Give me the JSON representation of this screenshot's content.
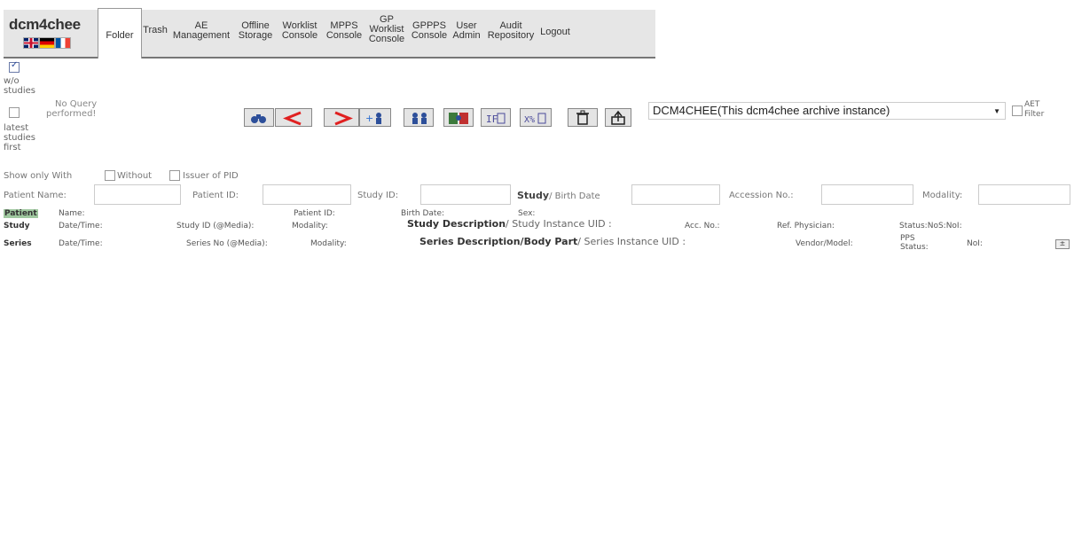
{
  "app": {
    "logo_text": "dcm4chee"
  },
  "nav": {
    "tabs": [
      {
        "lines": [
          "Folder"
        ]
      },
      {
        "lines": [
          "Trash"
        ]
      },
      {
        "lines": [
          "AE",
          "Management"
        ]
      },
      {
        "lines": [
          "Offline",
          "Storage"
        ]
      },
      {
        "lines": [
          "Worklist",
          "Console"
        ]
      },
      {
        "lines": [
          "MPPS",
          "Console"
        ]
      },
      {
        "lines": [
          "GP",
          "Worklist",
          "Console"
        ]
      },
      {
        "lines": [
          "GPPPS",
          "Console"
        ]
      },
      {
        "lines": [
          "User",
          "Admin"
        ]
      },
      {
        "lines": [
          "Audit",
          "Repository"
        ]
      },
      {
        "lines": [
          "Logout"
        ]
      }
    ]
  },
  "filters": {
    "wo_studies_checked": true,
    "wo_studies_label": [
      "w/o",
      "studies"
    ],
    "latest_first_label": [
      "latest",
      "studies",
      "first"
    ],
    "query_status": [
      "No Query",
      "performed!"
    ],
    "aet_selected": "DCM4CHEE(This dcm4chee archive instance)",
    "aet_filter_label": [
      "AET",
      "Filter"
    ],
    "show_only": "Show only",
    "with": "With",
    "without": "Without",
    "issuer_of_pid": "Issuer of PID"
  },
  "toolbar": {
    "buttons": [
      {
        "icon": "binoculars-search-icon"
      },
      {
        "icon": "previous-arrow-icon"
      },
      {
        "icon": "next-arrow-icon"
      },
      {
        "icon": "add-patient-icon"
      },
      {
        "icon": "merge-patients-icon"
      },
      {
        "icon": "move-patients-icon"
      },
      {
        "icon": "export-study-icon"
      },
      {
        "icon": "compare-studies-icon"
      },
      {
        "icon": "delete-trash-icon"
      },
      {
        "icon": "send-upload-icon"
      }
    ]
  },
  "search": {
    "patient_name": "Patient Name:",
    "patient_id": "Patient ID:",
    "study_id": "Study ID:",
    "study": "Study",
    "birth_date": "/ Birth Date",
    "accession_no": "Accession No.:",
    "modality": "Modality:"
  },
  "headers": {
    "patient": {
      "tag": "Patient",
      "name": "Name:",
      "patient_id": "Patient ID:",
      "birth_date": "Birth Date:",
      "sex": "Sex:"
    },
    "study": {
      "tag": "Study",
      "datetime": "Date/Time:",
      "study_id": "Study ID (@Media):",
      "modality": "Modality:",
      "description_bold": "Study Description",
      "description_rest": "/ Study Instance UID :",
      "acc_no": "Acc. No.:",
      "ref_physician": "Ref. Physician:",
      "status": "Status:NoS:NoI:"
    },
    "series": {
      "tag": "Series",
      "datetime": "Date/Time:",
      "series_no": "Series No (@Media):",
      "modality": "Modality:",
      "description_bold": "Series Description/Body Part",
      "description_rest": "/ Series Instance UID :",
      "vendor": "Vendor/Model:",
      "pps_status": [
        "PPS",
        "Status:"
      ],
      "noi": "NoI:"
    }
  },
  "colors": {
    "patient_tag_bg": "#9fc89f",
    "nav_bg": "#e6e6e6",
    "arrow_red": "#e02020"
  }
}
